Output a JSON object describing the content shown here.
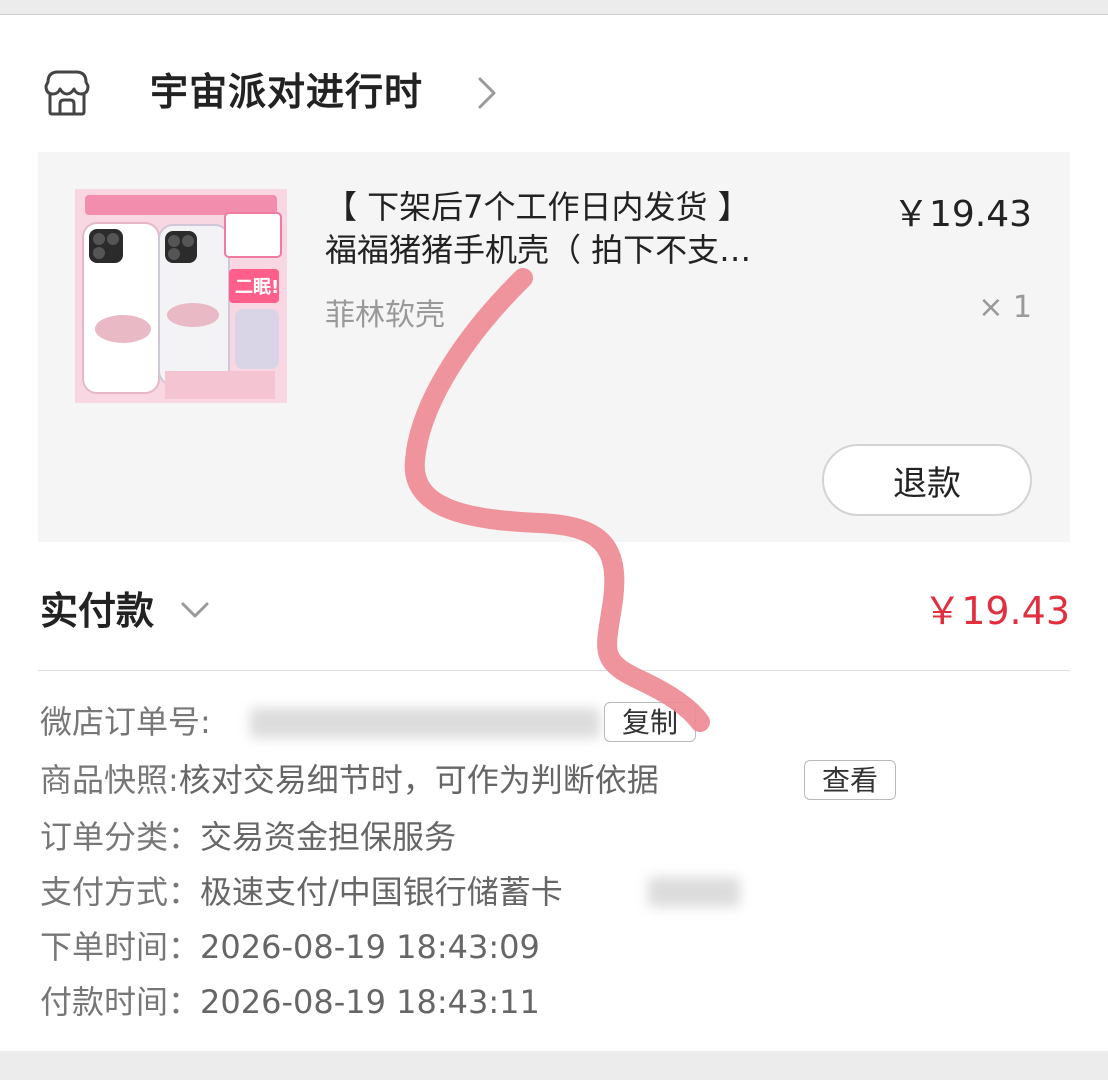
{
  "shop": {
    "name": "宇宙派对进行时",
    "icon": "shop-icon",
    "chevron": "chevron-right-icon"
  },
  "product": {
    "title_line1": "【 下架后7个工作日内发货 】",
    "title_line2": "福福猪猪手机壳（ 拍下不支…",
    "price": "￥19.43",
    "variant": "菲林软壳",
    "quantity": "× 1",
    "refund_label": "退款",
    "thumbnail_text": [
      "二眠!"
    ]
  },
  "payment": {
    "label": "实付款",
    "amount": "￥19.43",
    "accent_color": "#e0303f"
  },
  "info": {
    "order_no_label": "微店订单号:",
    "copy_label": "复制",
    "snapshot_label": "商品快照:",
    "snapshot_value": "核对交易细节时，可作为判断依据",
    "view_label": "查看",
    "category_label": "订单分类：",
    "category_value": "交易资金担保服务",
    "pay_method_label": "支付方式：",
    "pay_method_value": "极速支付/中国银行储蓄卡",
    "order_time_label": "下单时间：",
    "order_time_value": "2026-08-19 18:43:09",
    "pay_time_label": "付款时间：",
    "pay_time_value": "2026-08-19 18:43:11"
  },
  "annotation": {
    "stroke_color": "#ee8a94"
  }
}
